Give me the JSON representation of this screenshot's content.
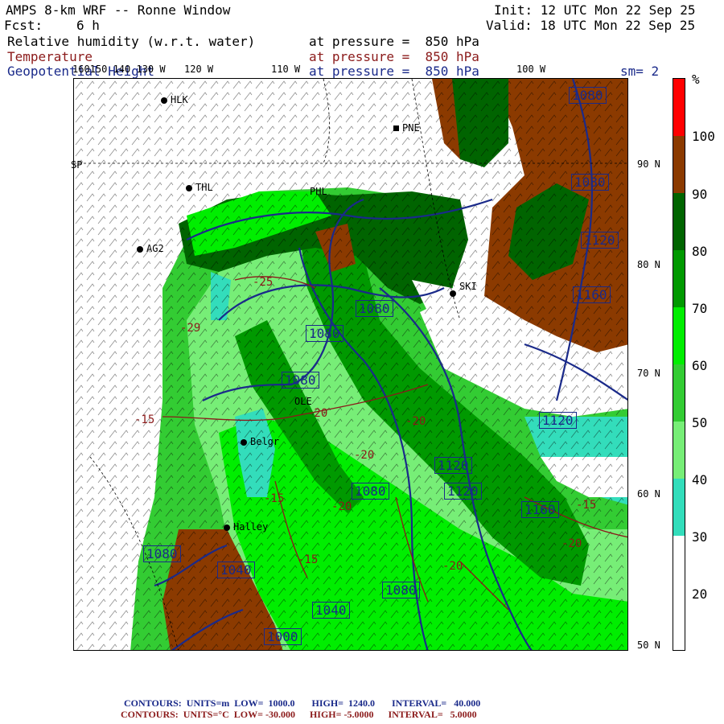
{
  "header": {
    "title": "AMPS 8-km WRF -- Ronne Window",
    "forecast_label": "Fcst:",
    "forecast_hours": "6 h",
    "init_label": "Init: 12 UTC Mon 22 Sep 25",
    "valid_label": "Valid: 18 UTC Mon 22 Sep 25",
    "fields": [
      {
        "name": "Relative humidity (w.r.t. water)",
        "level": "at pressure =  850 hPa",
        "color": "#000000"
      },
      {
        "name": "Temperature",
        "level": "at pressure =  850 hPa",
        "color": "#8b1a1a"
      },
      {
        "name": "Geopotential Height",
        "level": "at pressure =  850 hPa",
        "color": "#1a2a8a"
      }
    ],
    "smoothing": "sm= 2"
  },
  "map": {
    "lon_labels": [
      "160150 140 130 W",
      "120 W",
      "110 W",
      "100 W"
    ],
    "lat_labels": [
      "90 N",
      "80 N",
      "70 N",
      "60 N",
      "50 N"
    ],
    "sp_label": "SP",
    "stations": [
      "HLK",
      "PNE",
      "THL",
      "PHL",
      "AG2",
      "SKI",
      "OLE",
      "Belgr",
      "Halley"
    ],
    "height_contours": [
      "1080",
      "1080",
      "1080",
      "1080",
      "1080",
      "1080",
      "1080",
      "1120",
      "1160",
      "1120",
      "1080",
      "1120",
      "1160",
      "1120",
      "1080",
      "1040",
      "1080",
      "1040",
      "1000"
    ],
    "temp_contours": [
      "-25",
      "-29",
      "-15",
      "-20",
      "-20",
      "-20",
      "-20",
      "-25",
      "-15",
      "-20",
      "-15",
      "-20",
      "-20",
      "-15"
    ]
  },
  "colorbar": {
    "unit": "%",
    "labels": [
      "100",
      "90",
      "80",
      "70",
      "60",
      "50",
      "40",
      "30",
      "20"
    ],
    "colors": [
      "#ff0000",
      "#8b3a00",
      "#006400",
      "#009900",
      "#00ee00",
      "#33cc33",
      "#77ee77",
      "#33ddbb",
      "#ffffff"
    ]
  },
  "footer": {
    "line1": "CONTOURS:  UNITS=m  LOW=  1000.0       HIGH=  1240.0       INTERVAL=   40.000",
    "line2": "CONTOURS:  UNITS=°C  LOW= -30.000      HIGH= -5.0000      INTERVAL=   5.0000"
  }
}
